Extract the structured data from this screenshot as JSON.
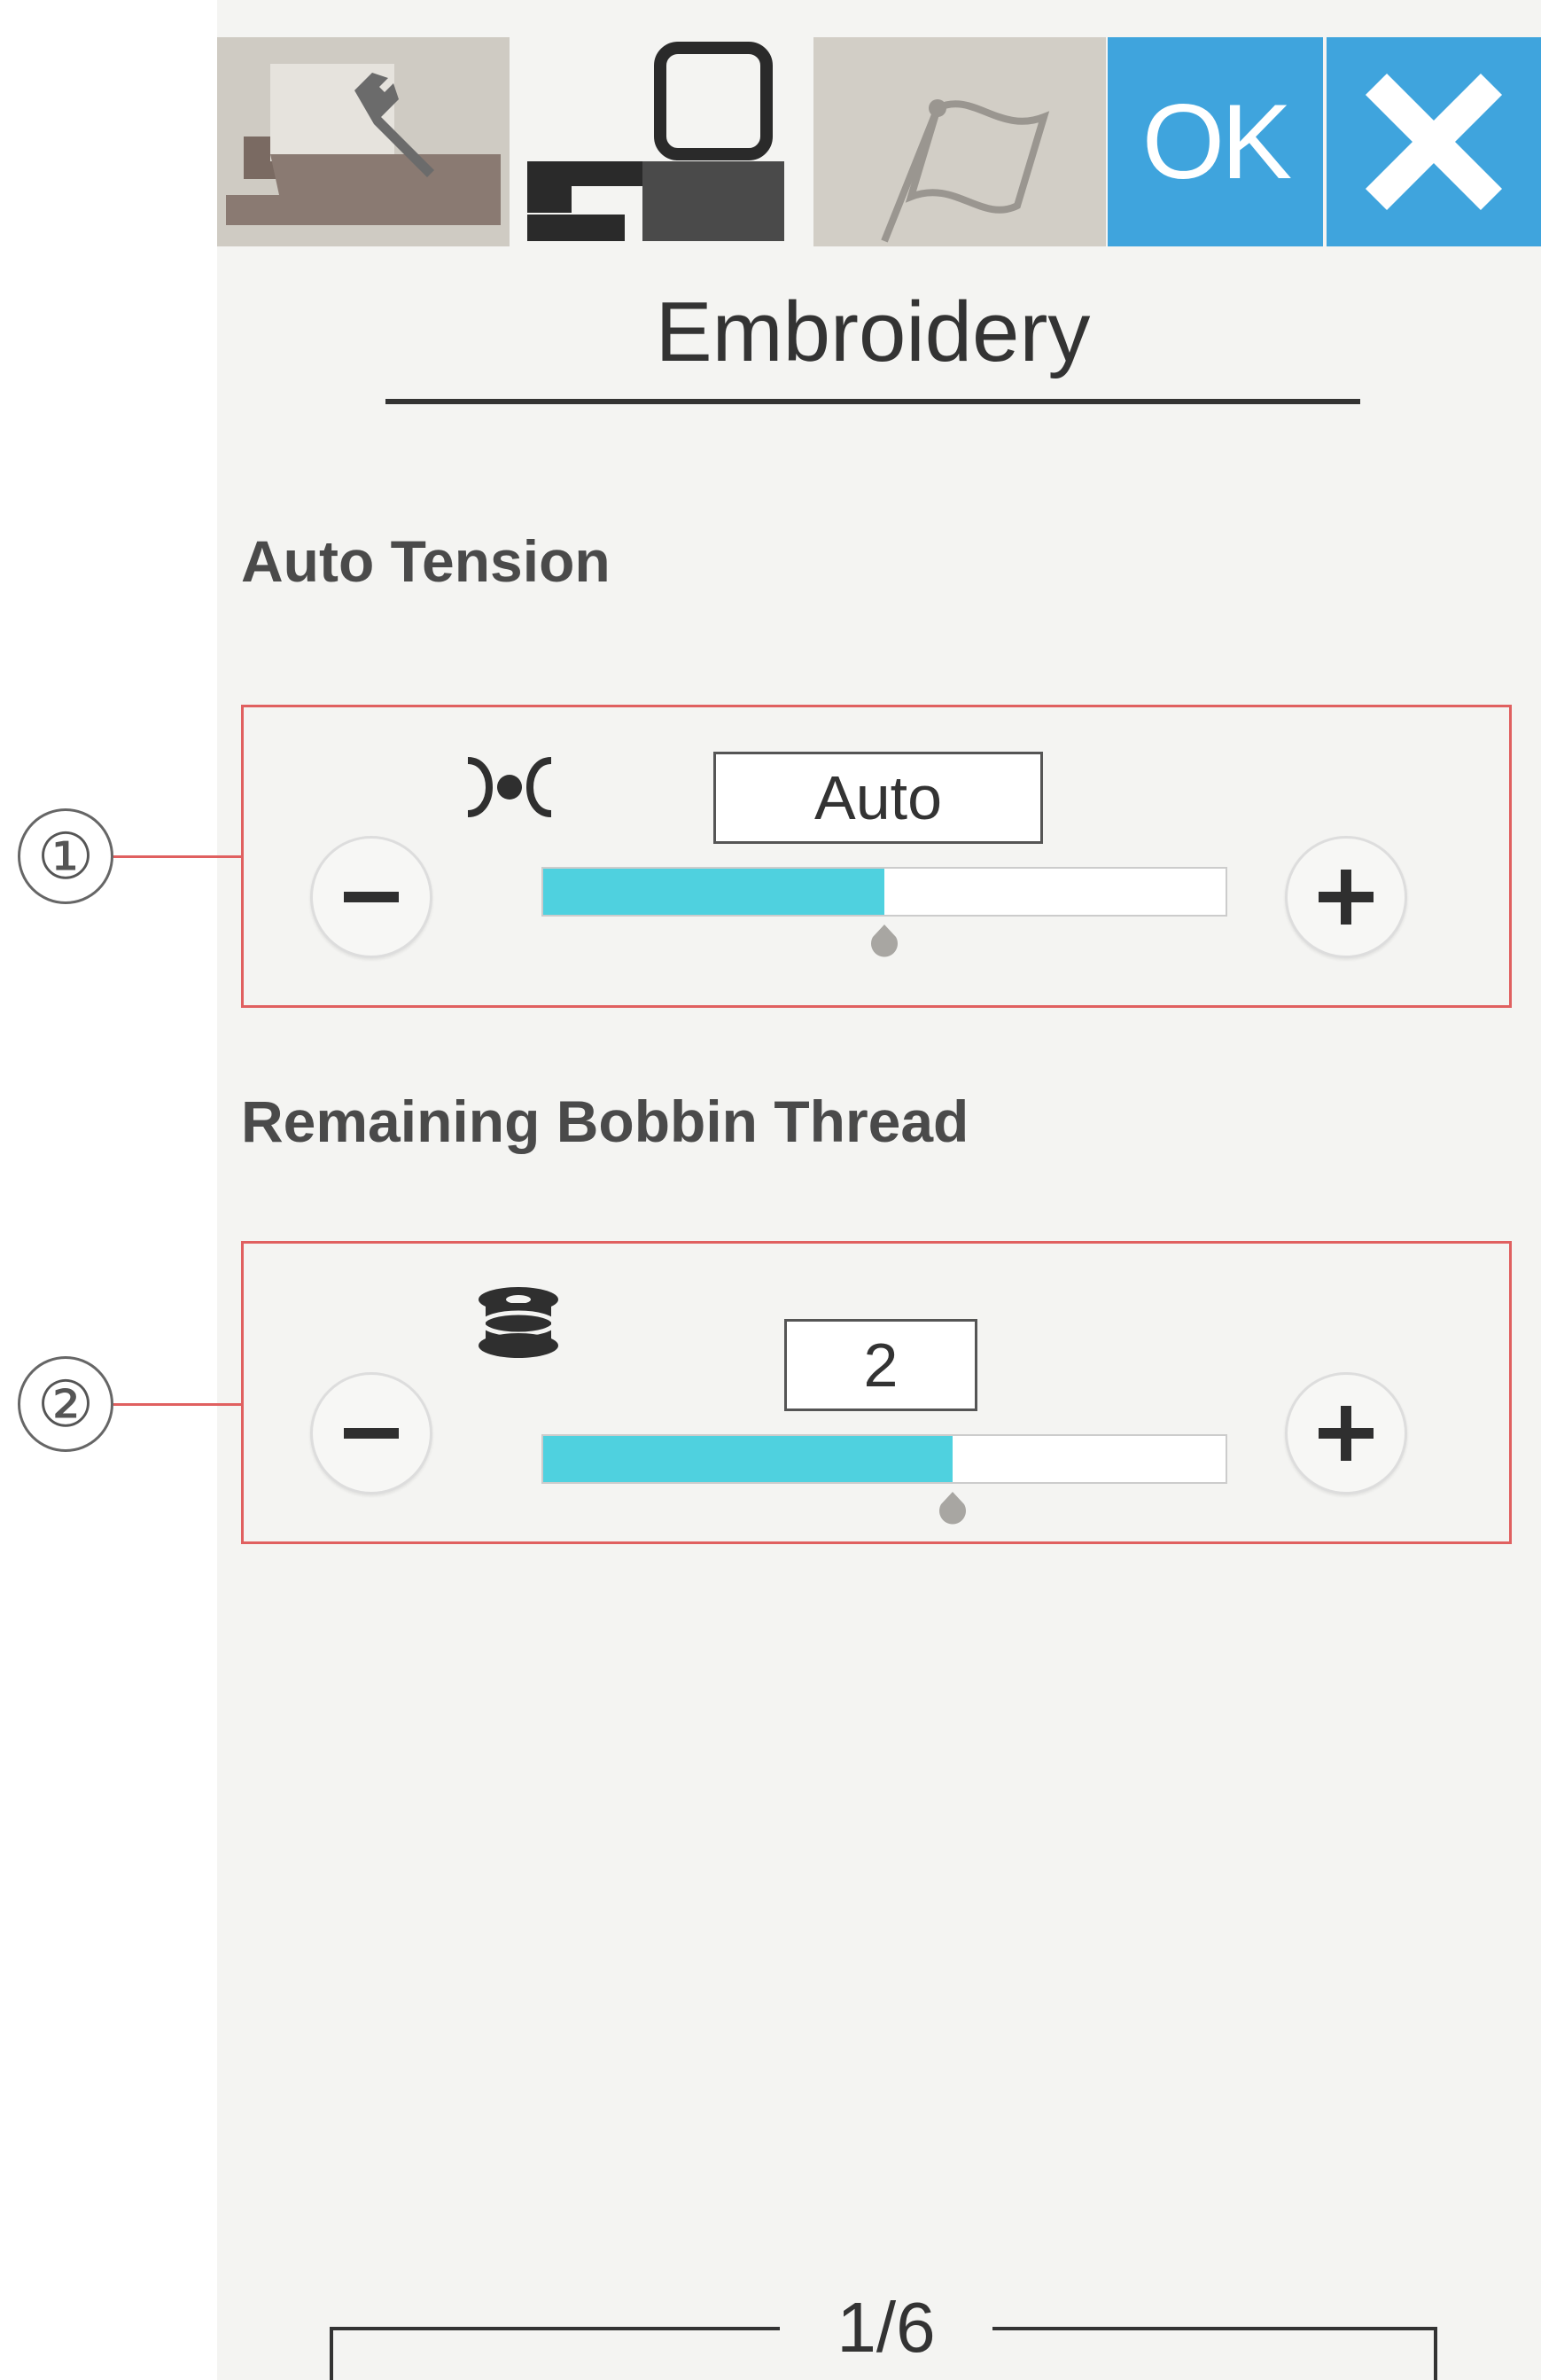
{
  "toolbar": {
    "tabs": [
      {
        "name": "sewing-settings",
        "icon": "machine-wrench-icon",
        "active": false
      },
      {
        "name": "embroidery-settings",
        "icon": "embroidery-machine-icon",
        "active": true
      },
      {
        "name": "language-settings",
        "icon": "flag-icon",
        "active": false
      }
    ],
    "ok_label": "OK",
    "close_icon": "close-icon",
    "accent_color": "#3fa4dd"
  },
  "page_title": "Embroidery",
  "sections": {
    "auto_tension": {
      "label": "Auto Tension",
      "icon": "thread-tension-icon",
      "value": "Auto",
      "level_fraction": 0.5,
      "callout": "①"
    },
    "bobbin_thread": {
      "label": "Remaining Bobbin Thread",
      "icon": "bobbin-icon",
      "value": "2",
      "level_fraction": 0.6,
      "callout": "②"
    }
  },
  "pagination": {
    "label": "1/6"
  }
}
